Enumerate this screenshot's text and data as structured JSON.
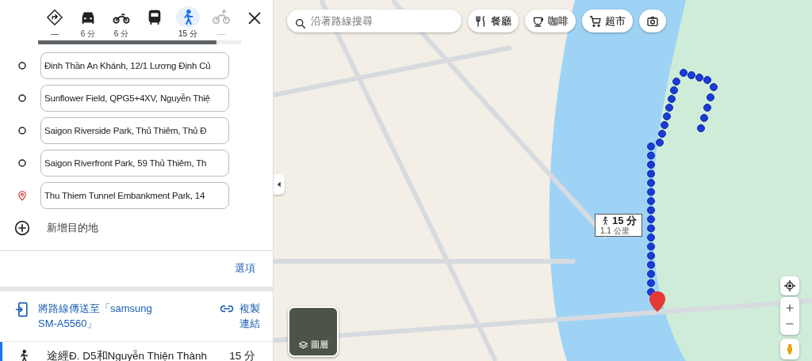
{
  "travel_modes": [
    {
      "kind": "best",
      "label": "—",
      "selected": false,
      "disabled": false
    },
    {
      "kind": "car",
      "label": "6 分",
      "selected": false,
      "disabled": false
    },
    {
      "kind": "motorbike",
      "label": "6 分",
      "selected": false,
      "disabled": false
    },
    {
      "kind": "transit",
      "selected": false,
      "disabled": false
    },
    {
      "kind": "walk",
      "label": "15 分",
      "selected": true,
      "disabled": false
    },
    {
      "kind": "bike",
      "label": "—",
      "selected": false,
      "disabled": true
    }
  ],
  "loading": {
    "level": 0.88
  },
  "waypoints": [
    {
      "kind": "stop",
      "value": "Đinh Thần An Khánh, 12/1 Lương Định Củ"
    },
    {
      "kind": "stop",
      "value": "Sunflower Field, QPG5+4XV, Nguyễn Thiệ"
    },
    {
      "kind": "stop",
      "value": "Saigon Riverside Park, Thủ Thiêm, Thủ Đ"
    },
    {
      "kind": "stop",
      "value": "Saigon Riverfront Park, 59 Thủ Thiêm, Th"
    },
    {
      "kind": "destination",
      "value": "Thu Thiem Tunnel Embankment Park, 14"
    }
  ],
  "add_destination": "新增目的地",
  "options_link": "選項",
  "send_route": "將路線傳送至「samsung SM-A5560」",
  "copy_link": "複製連結",
  "route": {
    "via": "途經Đ. D5和Nguyễn Thiện Thành",
    "duration": "15 分"
  },
  "map": {
    "search": {
      "placeholder": "沿著路線搜尋"
    },
    "chips": [
      {
        "kind": "restaurant",
        "label": "餐廳"
      },
      {
        "kind": "cafe",
        "label": "咖啡"
      },
      {
        "kind": "grocery",
        "label": "超市"
      },
      {
        "kind": "camera"
      }
    ],
    "route_callout": {
      "duration": "15 分",
      "distance": "1.1 公里"
    },
    "layers_label": "圖層"
  }
}
